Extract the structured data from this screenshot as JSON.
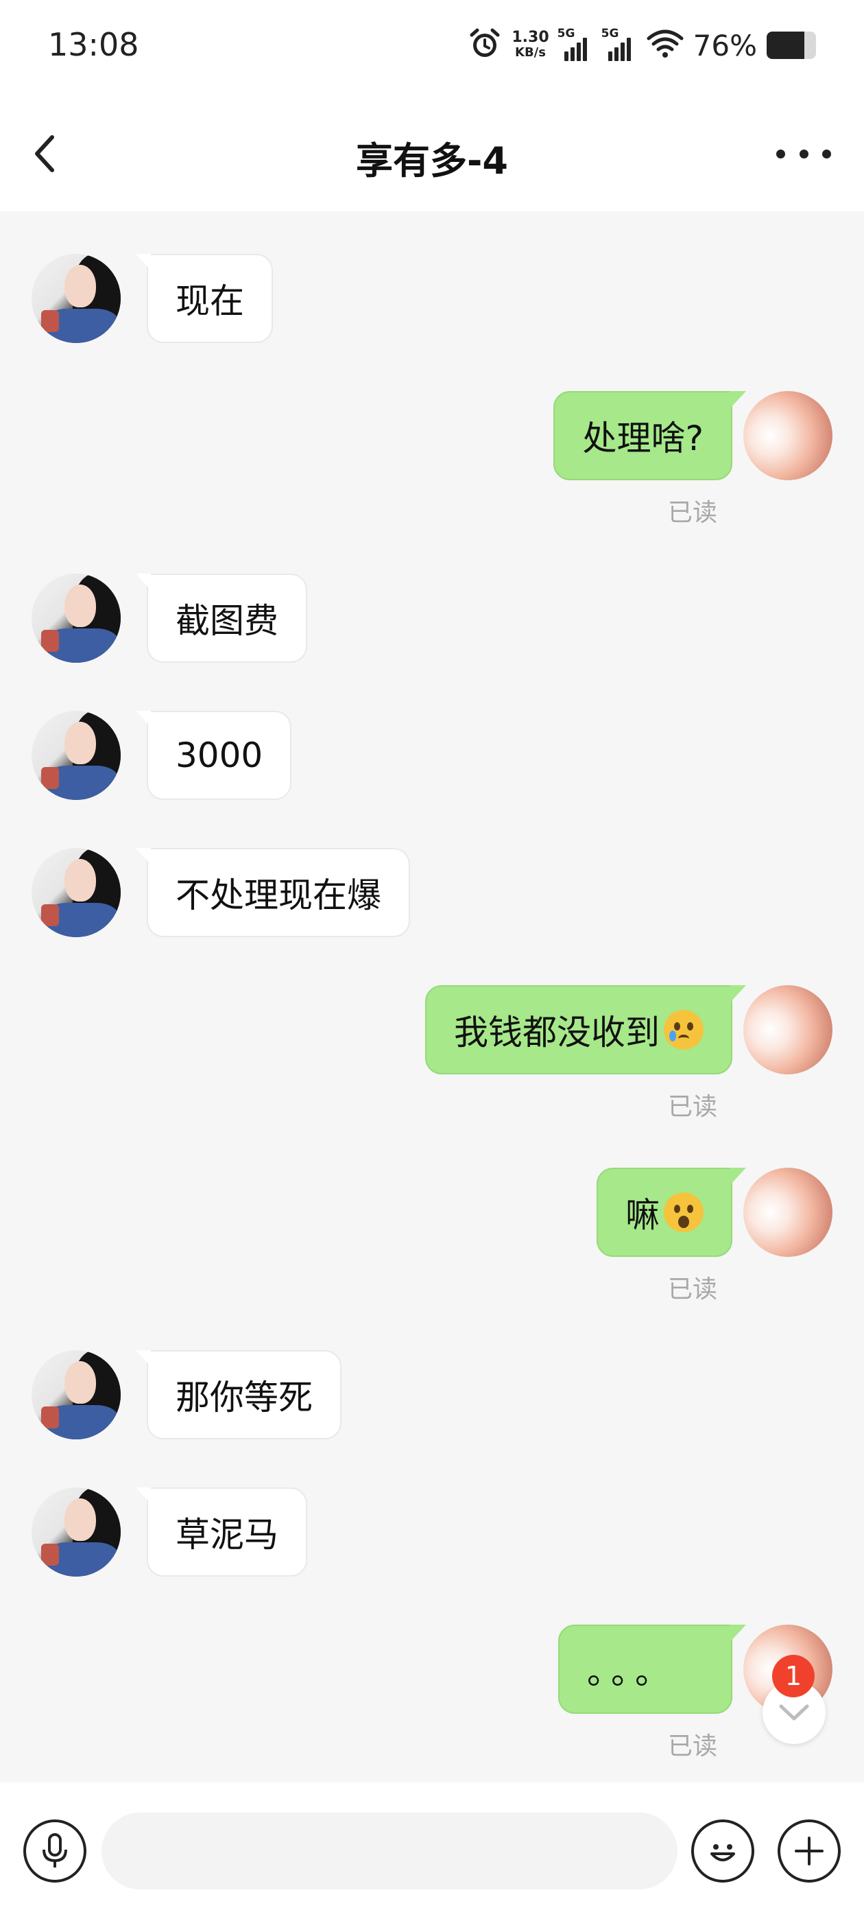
{
  "status_bar": {
    "time": "13:08",
    "net_speed_value": "1.30",
    "net_speed_unit": "KB/s",
    "sim1_label": "5G",
    "sim2_label": "5G",
    "battery_percent": "76%",
    "battery_level": 0.76
  },
  "header": {
    "title": "享有多-4",
    "back_icon": "chevron-left-icon",
    "more_icon": "more-horizontal-icon"
  },
  "messages": [
    {
      "side": "left",
      "text": "现在"
    },
    {
      "side": "right",
      "text": "处理啥?",
      "read": "已读"
    },
    {
      "side": "left",
      "text": "截图费"
    },
    {
      "side": "left",
      "text": "3000"
    },
    {
      "side": "left",
      "text": "不处理现在爆"
    },
    {
      "side": "right",
      "text": "我钱都没收到",
      "emoji": "crying-face",
      "read": "已读"
    },
    {
      "side": "right",
      "text": "嘛",
      "emoji": "astonished-face",
      "read": "已读"
    },
    {
      "side": "left",
      "text": "那你等死"
    },
    {
      "side": "left",
      "text": "草泥马"
    },
    {
      "side": "right",
      "text": "。。。",
      "read": "已读"
    }
  ],
  "scroll_down": {
    "unread_count": "1",
    "icon": "chevron-down-icon"
  },
  "input_bar": {
    "voice_icon": "microphone-icon",
    "message_placeholder": "",
    "emoji_icon": "smiley-icon",
    "add_icon": "plus-icon"
  }
}
